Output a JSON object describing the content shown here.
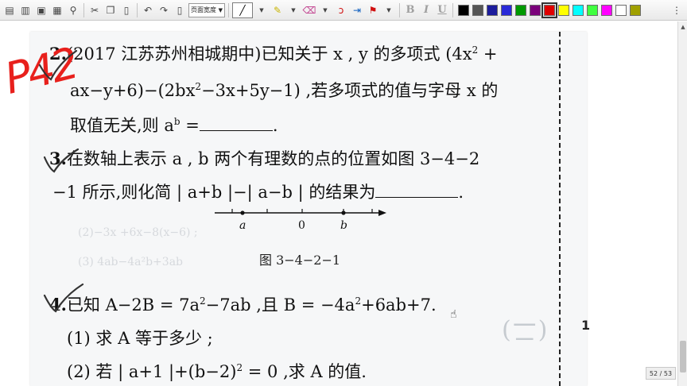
{
  "toolbar": {
    "zoom_select": "页面宽度",
    "bold_label": "B",
    "italic_label": "I",
    "underline_label": "U",
    "colors": [
      "#000000",
      "#555555",
      "#1c1c9c",
      "#2a2ad8",
      "#009900",
      "#7a007a",
      "#e00000",
      "#ffff00",
      "#00ffff",
      "#40ff40",
      "#ff00ff",
      "#ffffff",
      "#a0a000"
    ],
    "selected_color": "#e00000"
  },
  "document": {
    "q2": {
      "num": "2.",
      "line1": "(2017 江苏苏州相城期中)已知关于 x , y 的多项式 (4x",
      "sup1": "2",
      "line1_end": " +",
      "line2": "ax−y+6)−(2bx",
      "sup2": "2",
      "line2_end": "−3x+5y−1) ,若多项式的值与字母 x 的",
      "line3": "取值无关,则 a",
      "sup3": "b",
      "line3_end": " =",
      "line3_period": "."
    },
    "q3": {
      "num": "3.",
      "line1": "在数轴上表示 a , b 两个有理数的点的位置如图 3−4−2",
      "line2": "−1 所示,则化简 | a+b |−| a−b | 的结果为",
      "line2_period": ".",
      "axis_labels": [
        "a",
        "0",
        "b"
      ],
      "caption": "图 3−4−2−1"
    },
    "q4": {
      "num": "4.",
      "line1": "已知 A−2B = 7a",
      "sup1": "2",
      "line1_mid": "−7ab ,且 B = −4a",
      "sup2": "2",
      "line1_end": "+6ab+7.",
      "part1": "(1) 求 A 等于多少 ;",
      "part2": "(2) 若 | a+1 |+(b−2)",
      "part2_sup": "2",
      "part2_end": " = 0 ,求 A 的值."
    },
    "ghost_lines": [
      "(2)−3x +6x−8(x−6) ;",
      "(3) 4ab−4a²b+3ab",
      "(二)"
    ],
    "side_mark": "1",
    "handwriting": "P42"
  },
  "status": {
    "page_counter": "52 / 53"
  }
}
